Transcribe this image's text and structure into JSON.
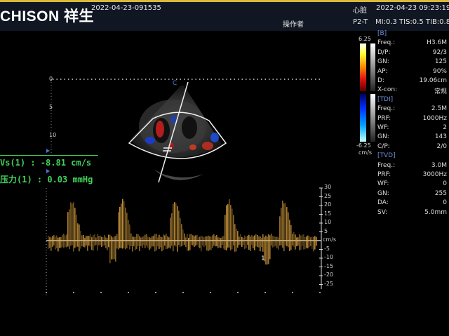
{
  "header": {
    "brand": "CHISON 祥生",
    "patient_id": "2022-04-23-091535",
    "exam": "心脏",
    "datetime": "2022-04-23 09:23:19",
    "operator_label": "操作者",
    "probe": "P2-T",
    "indices": "MI:0.3 TIS:0.5 TIB:0.8"
  },
  "color_scale": {
    "top": "6.25",
    "bottom": "-6.25",
    "unit": "cm/s"
  },
  "params": {
    "b_title": "[B]",
    "b": [
      {
        "label": "Freq.:",
        "value": "H3.6M"
      },
      {
        "label": "D/P:",
        "value": "92/3"
      },
      {
        "label": "GN:",
        "value": "125"
      },
      {
        "label": "AP:",
        "value": "90%"
      },
      {
        "label": "D:",
        "value": "19.06cm"
      },
      {
        "label": "X-con:",
        "value": "常规"
      }
    ],
    "tdi_title": "[TDI]",
    "tdi": [
      {
        "label": "Freq.:",
        "value": "2.5M"
      },
      {
        "label": "PRF:",
        "value": "1000Hz"
      },
      {
        "label": "WF:",
        "value": "2"
      },
      {
        "label": "GN:",
        "value": "143"
      },
      {
        "label": "C/P:",
        "value": "2/0"
      }
    ],
    "tvd_title": "[TVD]",
    "tvd": [
      {
        "label": "Freq.:",
        "value": "3.0M"
      },
      {
        "label": "PRF:",
        "value": "3000Hz"
      },
      {
        "label": "WF:",
        "value": "0"
      },
      {
        "label": "GN:",
        "value": "255"
      },
      {
        "label": "DA:",
        "value": "0"
      },
      {
        "label": "SV:",
        "value": "5.0mm"
      }
    ]
  },
  "measurements": {
    "vs": "Vs(1) : -8.81 cm/s",
    "pressure": "压力(1) : 0.03 mmHg"
  },
  "depth_scale": [
    "0",
    "5",
    "10"
  ],
  "cursor_label": "C",
  "doppler_scale": {
    "ticks": [
      "30",
      "25",
      "20",
      "15",
      "10",
      "5",
      "-5",
      "-10",
      "-15",
      "-20",
      "-25"
    ],
    "unit": "cm/s"
  },
  "doppler_marker": "1",
  "colors": {
    "accent": "#d8b93c",
    "measure": "#41d05a",
    "section": "#6f8fd8",
    "spectrum": "#e0a640"
  }
}
